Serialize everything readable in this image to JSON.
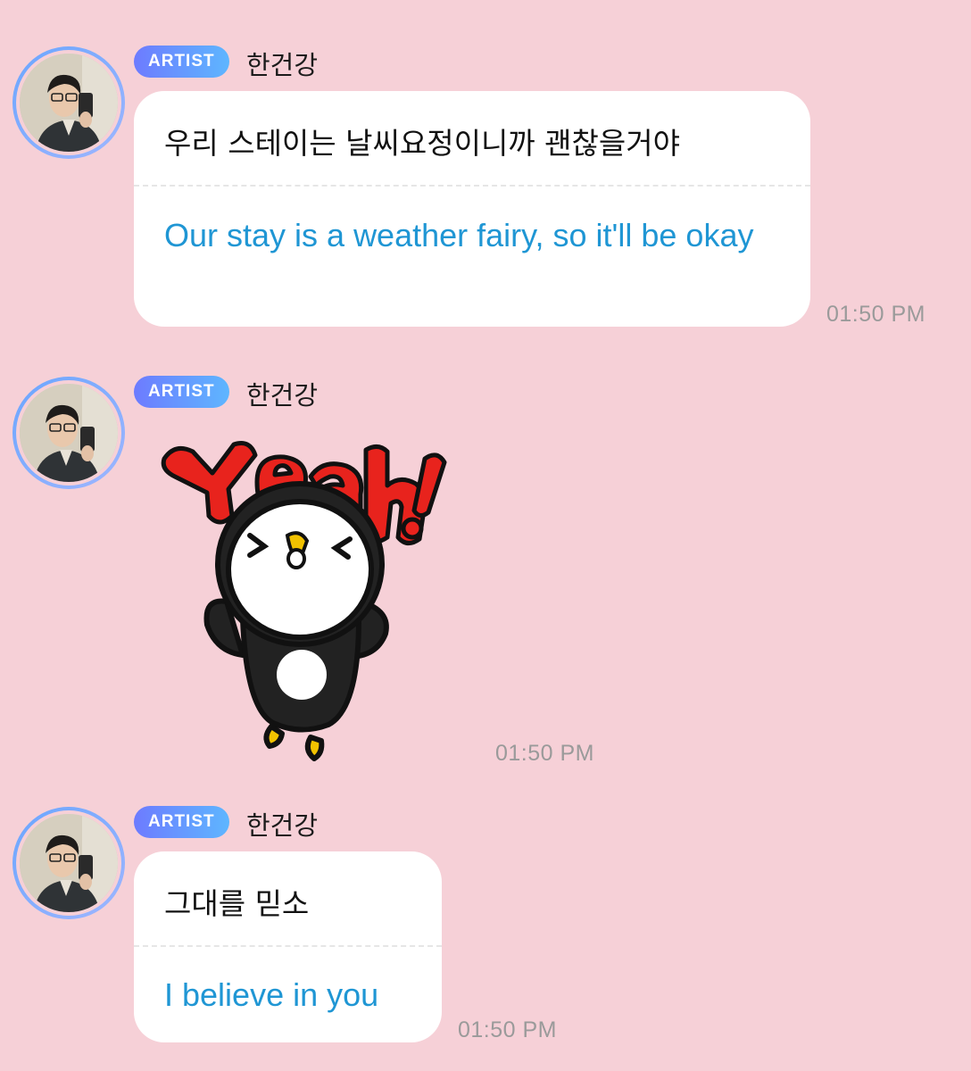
{
  "messages": [
    {
      "badge": "ARTIST",
      "sender": "한건강",
      "original": "우리 스테이는 날씨요정이니까 괜찮을거야",
      "translation": "Our stay is a weather fairy, so it'll be okay",
      "time": "01:50 PM"
    },
    {
      "badge": "ARTIST",
      "sender": "한건강",
      "sticker": "penguin-yeah-sticker",
      "time": "01:50 PM"
    },
    {
      "badge": "ARTIST",
      "sender": "한건강",
      "original": "그대를 믿소",
      "translation": "I believe in you",
      "time": "01:50 PM"
    }
  ],
  "colors": {
    "background": "#f6d0d7",
    "badge_start": "#6d7bff",
    "badge_end": "#5eb6ff",
    "translation_text": "#1f96d4",
    "timestamp": "#9a9a9a"
  }
}
